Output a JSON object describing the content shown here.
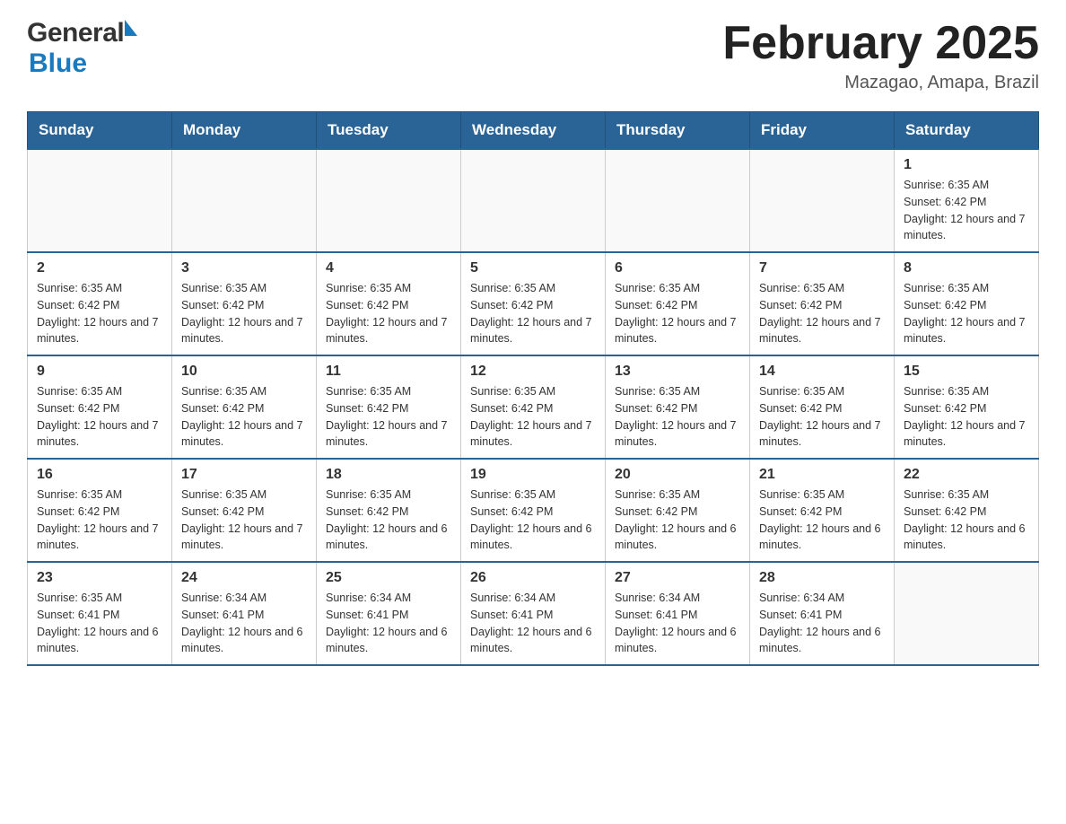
{
  "header": {
    "logo_general": "General",
    "logo_blue": "Blue",
    "month_title": "February 2025",
    "location": "Mazagao, Amapa, Brazil"
  },
  "days_of_week": [
    "Sunday",
    "Monday",
    "Tuesday",
    "Wednesday",
    "Thursday",
    "Friday",
    "Saturday"
  ],
  "weeks": [
    [
      {
        "day": "",
        "info": ""
      },
      {
        "day": "",
        "info": ""
      },
      {
        "day": "",
        "info": ""
      },
      {
        "day": "",
        "info": ""
      },
      {
        "day": "",
        "info": ""
      },
      {
        "day": "",
        "info": ""
      },
      {
        "day": "1",
        "info": "Sunrise: 6:35 AM\nSunset: 6:42 PM\nDaylight: 12 hours and 7 minutes."
      }
    ],
    [
      {
        "day": "2",
        "info": "Sunrise: 6:35 AM\nSunset: 6:42 PM\nDaylight: 12 hours and 7 minutes."
      },
      {
        "day": "3",
        "info": "Sunrise: 6:35 AM\nSunset: 6:42 PM\nDaylight: 12 hours and 7 minutes."
      },
      {
        "day": "4",
        "info": "Sunrise: 6:35 AM\nSunset: 6:42 PM\nDaylight: 12 hours and 7 minutes."
      },
      {
        "day": "5",
        "info": "Sunrise: 6:35 AM\nSunset: 6:42 PM\nDaylight: 12 hours and 7 minutes."
      },
      {
        "day": "6",
        "info": "Sunrise: 6:35 AM\nSunset: 6:42 PM\nDaylight: 12 hours and 7 minutes."
      },
      {
        "day": "7",
        "info": "Sunrise: 6:35 AM\nSunset: 6:42 PM\nDaylight: 12 hours and 7 minutes."
      },
      {
        "day": "8",
        "info": "Sunrise: 6:35 AM\nSunset: 6:42 PM\nDaylight: 12 hours and 7 minutes."
      }
    ],
    [
      {
        "day": "9",
        "info": "Sunrise: 6:35 AM\nSunset: 6:42 PM\nDaylight: 12 hours and 7 minutes."
      },
      {
        "day": "10",
        "info": "Sunrise: 6:35 AM\nSunset: 6:42 PM\nDaylight: 12 hours and 7 minutes."
      },
      {
        "day": "11",
        "info": "Sunrise: 6:35 AM\nSunset: 6:42 PM\nDaylight: 12 hours and 7 minutes."
      },
      {
        "day": "12",
        "info": "Sunrise: 6:35 AM\nSunset: 6:42 PM\nDaylight: 12 hours and 7 minutes."
      },
      {
        "day": "13",
        "info": "Sunrise: 6:35 AM\nSunset: 6:42 PM\nDaylight: 12 hours and 7 minutes."
      },
      {
        "day": "14",
        "info": "Sunrise: 6:35 AM\nSunset: 6:42 PM\nDaylight: 12 hours and 7 minutes."
      },
      {
        "day": "15",
        "info": "Sunrise: 6:35 AM\nSunset: 6:42 PM\nDaylight: 12 hours and 7 minutes."
      }
    ],
    [
      {
        "day": "16",
        "info": "Sunrise: 6:35 AM\nSunset: 6:42 PM\nDaylight: 12 hours and 7 minutes."
      },
      {
        "day": "17",
        "info": "Sunrise: 6:35 AM\nSunset: 6:42 PM\nDaylight: 12 hours and 7 minutes."
      },
      {
        "day": "18",
        "info": "Sunrise: 6:35 AM\nSunset: 6:42 PM\nDaylight: 12 hours and 6 minutes."
      },
      {
        "day": "19",
        "info": "Sunrise: 6:35 AM\nSunset: 6:42 PM\nDaylight: 12 hours and 6 minutes."
      },
      {
        "day": "20",
        "info": "Sunrise: 6:35 AM\nSunset: 6:42 PM\nDaylight: 12 hours and 6 minutes."
      },
      {
        "day": "21",
        "info": "Sunrise: 6:35 AM\nSunset: 6:42 PM\nDaylight: 12 hours and 6 minutes."
      },
      {
        "day": "22",
        "info": "Sunrise: 6:35 AM\nSunset: 6:42 PM\nDaylight: 12 hours and 6 minutes."
      }
    ],
    [
      {
        "day": "23",
        "info": "Sunrise: 6:35 AM\nSunset: 6:41 PM\nDaylight: 12 hours and 6 minutes."
      },
      {
        "day": "24",
        "info": "Sunrise: 6:34 AM\nSunset: 6:41 PM\nDaylight: 12 hours and 6 minutes."
      },
      {
        "day": "25",
        "info": "Sunrise: 6:34 AM\nSunset: 6:41 PM\nDaylight: 12 hours and 6 minutes."
      },
      {
        "day": "26",
        "info": "Sunrise: 6:34 AM\nSunset: 6:41 PM\nDaylight: 12 hours and 6 minutes."
      },
      {
        "day": "27",
        "info": "Sunrise: 6:34 AM\nSunset: 6:41 PM\nDaylight: 12 hours and 6 minutes."
      },
      {
        "day": "28",
        "info": "Sunrise: 6:34 AM\nSunset: 6:41 PM\nDaylight: 12 hours and 6 minutes."
      },
      {
        "day": "",
        "info": ""
      }
    ]
  ]
}
